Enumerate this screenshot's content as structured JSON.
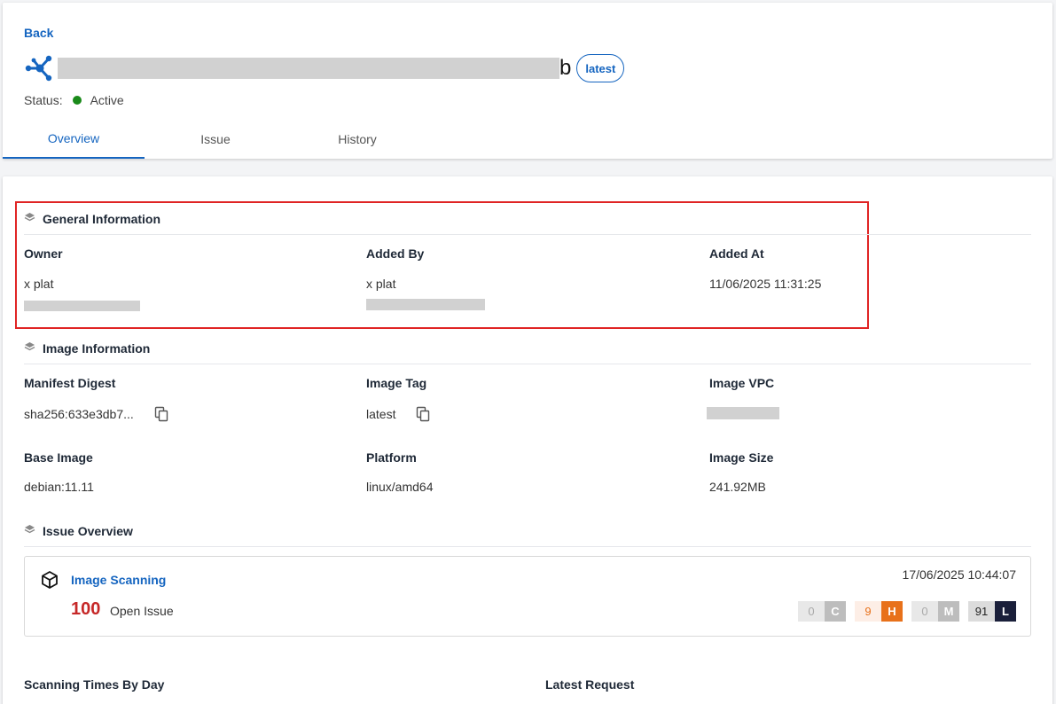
{
  "header": {
    "back_label": "Back",
    "title_suffix": "b",
    "tag_label": "latest",
    "status_label": "Status:",
    "status_value": "Active",
    "status_color": "#1a8a1a",
    "accent_color": "#1565c0"
  },
  "tabs": [
    {
      "label": "Overview",
      "active": true
    },
    {
      "label": "Issue",
      "active": false
    },
    {
      "label": "History",
      "active": false
    }
  ],
  "general": {
    "heading": "General Information",
    "owner_label": "Owner",
    "owner_value": "x plat",
    "added_by_label": "Added By",
    "added_by_value": "x plat",
    "added_at_label": "Added At",
    "added_at_value": "11/06/2025 11:31:25"
  },
  "image": {
    "heading": "Image Information",
    "digest_label": "Manifest Digest",
    "digest_value": "sha256:633e3db7...",
    "tag_label": "Image Tag",
    "tag_value": "latest",
    "vpc_label": "Image VPC",
    "base_label": "Base Image",
    "base_value": "debian:11.11",
    "platform_label": "Platform",
    "platform_value": "linux/amd64",
    "size_label": "Image Size",
    "size_value": "241.92MB"
  },
  "issue_overview": {
    "heading": "Issue Overview",
    "scan_title": "Image Scanning",
    "open_count": "100",
    "open_label": "Open Issue",
    "scan_time": "17/06/2025 10:44:07",
    "severities": [
      {
        "count": "0",
        "letter": "C",
        "count_bg": "#e8e8e8",
        "count_color": "#aaaaaa",
        "letter_bg": "#bdbdbd"
      },
      {
        "count": "9",
        "letter": "H",
        "count_bg": "#fdeee6",
        "count_color": "#e8711a",
        "letter_bg": "#e8711a"
      },
      {
        "count": "0",
        "letter": "M",
        "count_bg": "#e8e8e8",
        "count_color": "#aaaaaa",
        "letter_bg": "#bdbdbd"
      },
      {
        "count": "91",
        "letter": "L",
        "count_bg": "#dcdcdc",
        "count_color": "#222222",
        "letter_bg": "#1a1f3a"
      }
    ]
  },
  "bottom": {
    "scan_times_label": "Scanning Times By Day",
    "latest_request_label": "Latest Request"
  },
  "icons": {
    "title": "network-nodes-icon",
    "section": "layers-icon",
    "copy": "copy-icon",
    "scan": "cube-icon"
  }
}
